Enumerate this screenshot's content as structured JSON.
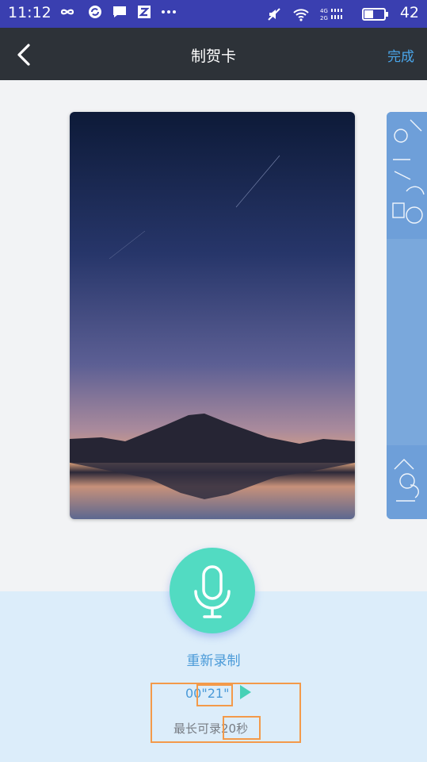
{
  "status_bar": {
    "time": "11:12",
    "left_icons": [
      "infinity-icon",
      "sync-icon",
      "message-icon",
      "z-app-icon",
      "more-icon"
    ],
    "battery_percent": "42",
    "network_labels": [
      "4G",
      "2G"
    ]
  },
  "header": {
    "title": "制贺卡",
    "done_label": "完成"
  },
  "recorder": {
    "rerecord_label": "重新录制",
    "duration": "00\"21\"",
    "max_note": "最长可录",
    "max_seconds": "20秒"
  },
  "colors": {
    "status_bar": "#3a3fb0",
    "header": "#2d3238",
    "accent": "#4aa6ea",
    "mic": "#52dbc2",
    "panel": "#dcedfa",
    "highlight": "#f39a4a"
  }
}
